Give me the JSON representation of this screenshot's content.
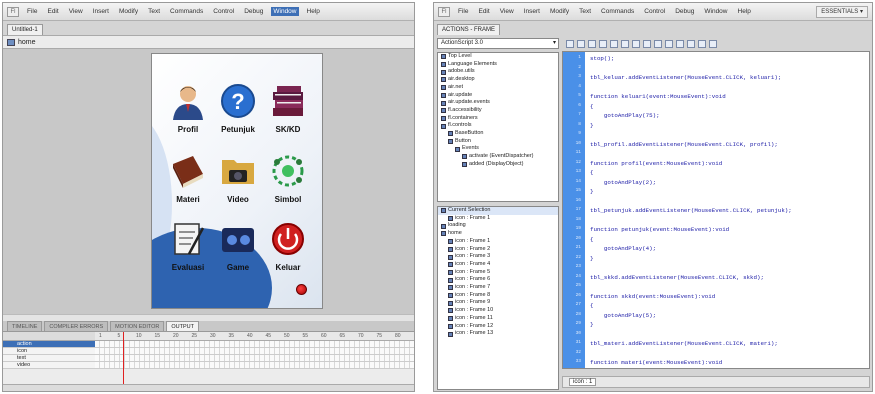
{
  "left_window": {
    "menu": [
      "File",
      "Edit",
      "View",
      "Insert",
      "Modify",
      "Text",
      "Commands",
      "Control",
      "Debug",
      "Window",
      "Help"
    ],
    "active_menu": "Window",
    "doc_tab": "Untitled-1",
    "scene_label": "home",
    "stage_items": [
      {
        "label": "Profil",
        "icon": "profile-person-icon"
      },
      {
        "label": "Petunjuk",
        "icon": "question-mark-icon"
      },
      {
        "label": "SK/KD",
        "icon": "stacked-books-icon"
      },
      {
        "label": "Materi",
        "icon": "book-icon"
      },
      {
        "label": "Video",
        "icon": "video-folder-icon"
      },
      {
        "label": "Simbol",
        "icon": "symbol-molecule-icon"
      },
      {
        "label": "Evaluasi",
        "icon": "evaluation-clipboard-icon"
      },
      {
        "label": "Game",
        "icon": "game-controller-icon"
      },
      {
        "label": "Keluar",
        "icon": "power-icon"
      }
    ],
    "panel_tabs": [
      "TIMELINE",
      "COMPILER ERRORS",
      "MOTION EDITOR",
      "OUTPUT"
    ],
    "timeline_ruler": [
      "1",
      "5",
      "10",
      "15",
      "20",
      "25",
      "30",
      "35",
      "40",
      "45",
      "50",
      "55",
      "60",
      "65",
      "70",
      "75",
      "80"
    ],
    "layers": [
      "action",
      "icon",
      "text",
      "video"
    ]
  },
  "right_window": {
    "menu": [
      "File",
      "Edit",
      "View",
      "Insert",
      "Modify",
      "Text",
      "Commands",
      "Control",
      "Debug",
      "Window",
      "Help"
    ],
    "workspace": "ESSENTIALS ▾",
    "panel_tab": "ACTIONS - FRAME",
    "script_version": "ActionScript 3.0",
    "library_tree": [
      "Top Level",
      "Language Elements",
      "adobe.utils",
      "air.desktop",
      "air.net",
      "air.update",
      "air.update.events",
      "fl.accessibility",
      "fl.containers",
      "fl.controls",
      "BaseButton",
      "Button",
      "Events",
      "activate (EventDispatcher)",
      "added (DisplayObject)"
    ],
    "scene_tree": [
      "Current Selection",
      "icon : Frame 1",
      "loading",
      "home",
      "icon : Frame 1",
      "icon : Frame 2",
      "icon : Frame 3",
      "icon : Frame 4",
      "icon : Frame 5",
      "icon : Frame 6",
      "icon : Frame 7",
      "icon : Frame 8",
      "icon : Frame 9",
      "icon : Frame 10",
      "icon : Frame 11",
      "icon : Frame 12",
      "icon : Frame 13"
    ],
    "code_lines": [
      "stop();",
      "",
      "tbl_keluar.addEventListener(MouseEvent.CLICK, keluar1);",
      "",
      "function keluar1(event:MouseEvent):void",
      "{",
      "    gotoAndPlay(75);",
      "}",
      "",
      "tbl_profil.addEventListener(MouseEvent.CLICK, profil);",
      "",
      "function profil(event:MouseEvent):void",
      "{",
      "    gotoAndPlay(2);",
      "}",
      "",
      "tbl_petunjuk.addEventListener(MouseEvent.CLICK, petunjuk);",
      "",
      "function petunjuk(event:MouseEvent):void",
      "{",
      "    gotoAndPlay(4);",
      "}",
      "",
      "tbl_skkd.addEventListener(MouseEvent.CLICK, skkd);",
      "",
      "function skkd(event:MouseEvent):void",
      "{",
      "    gotoAndPlay(5);",
      "}",
      "",
      "tbl_materi.addEventListener(MouseEvent.CLICK, materi);",
      "",
      "function materi(event:MouseEvent):void"
    ],
    "status_tab": "icon : 1"
  }
}
